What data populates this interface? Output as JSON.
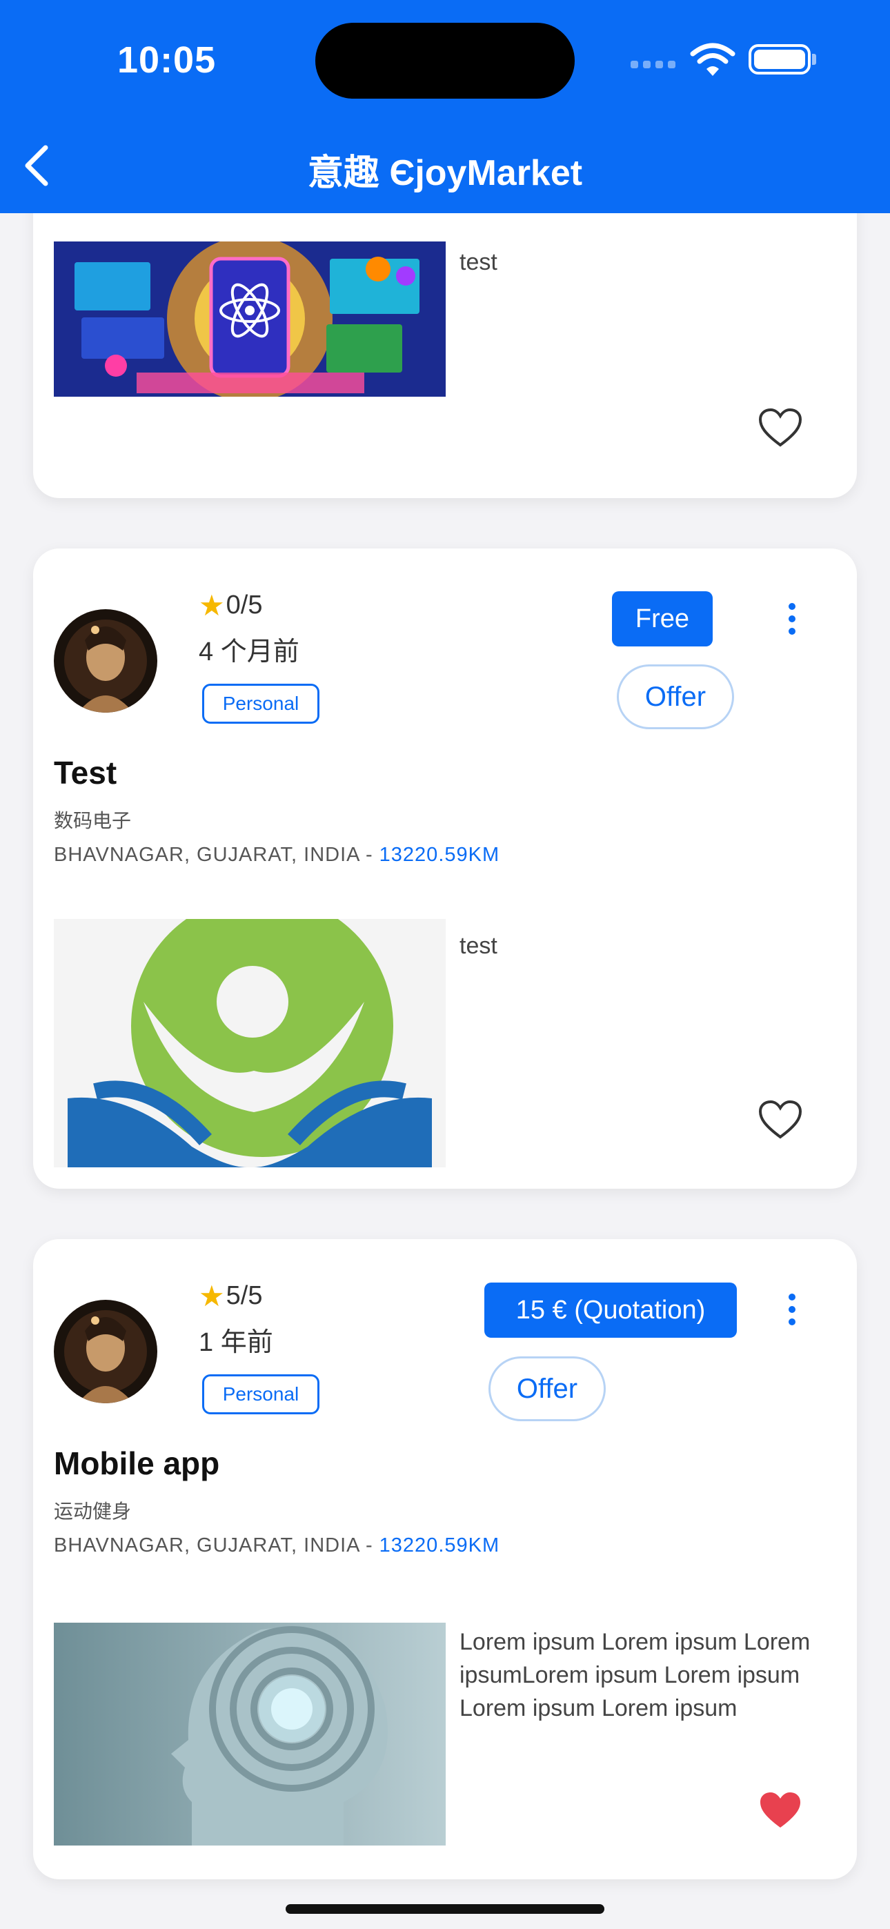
{
  "status_bar": {
    "time": "10:05"
  },
  "nav": {
    "title": "意趣 ЄjoyMarket"
  },
  "listings": [
    {
      "description": "test",
      "favorite": false
    },
    {
      "rating": "0/5",
      "ago": "4 个月前",
      "tag": "Personal",
      "price": "Free",
      "offer": "Offer",
      "title": "Test",
      "category": "数码电子",
      "location": "BHAVNAGAR, GUJARAT, INDIA - ",
      "distance": "13220.59KM",
      "description": "test",
      "favorite": false
    },
    {
      "rating": "5/5",
      "ago": "1 年前",
      "tag": "Personal",
      "price": "15 € (Quotation)",
      "offer": "Offer",
      "title": "Mobile app",
      "category": "运动健身",
      "location": "BHAVNAGAR, GUJARAT, INDIA - ",
      "distance": "13220.59KM",
      "description": "Lorem ipsum Lorem ipsum Lorem ipsumLorem ipsum Lorem ipsum Lorem ipsum Lorem ipsum",
      "favorite": true
    }
  ],
  "colors": {
    "accent": "#0a6cf5",
    "favorite": "#e8414f",
    "star": "#f6b800"
  }
}
